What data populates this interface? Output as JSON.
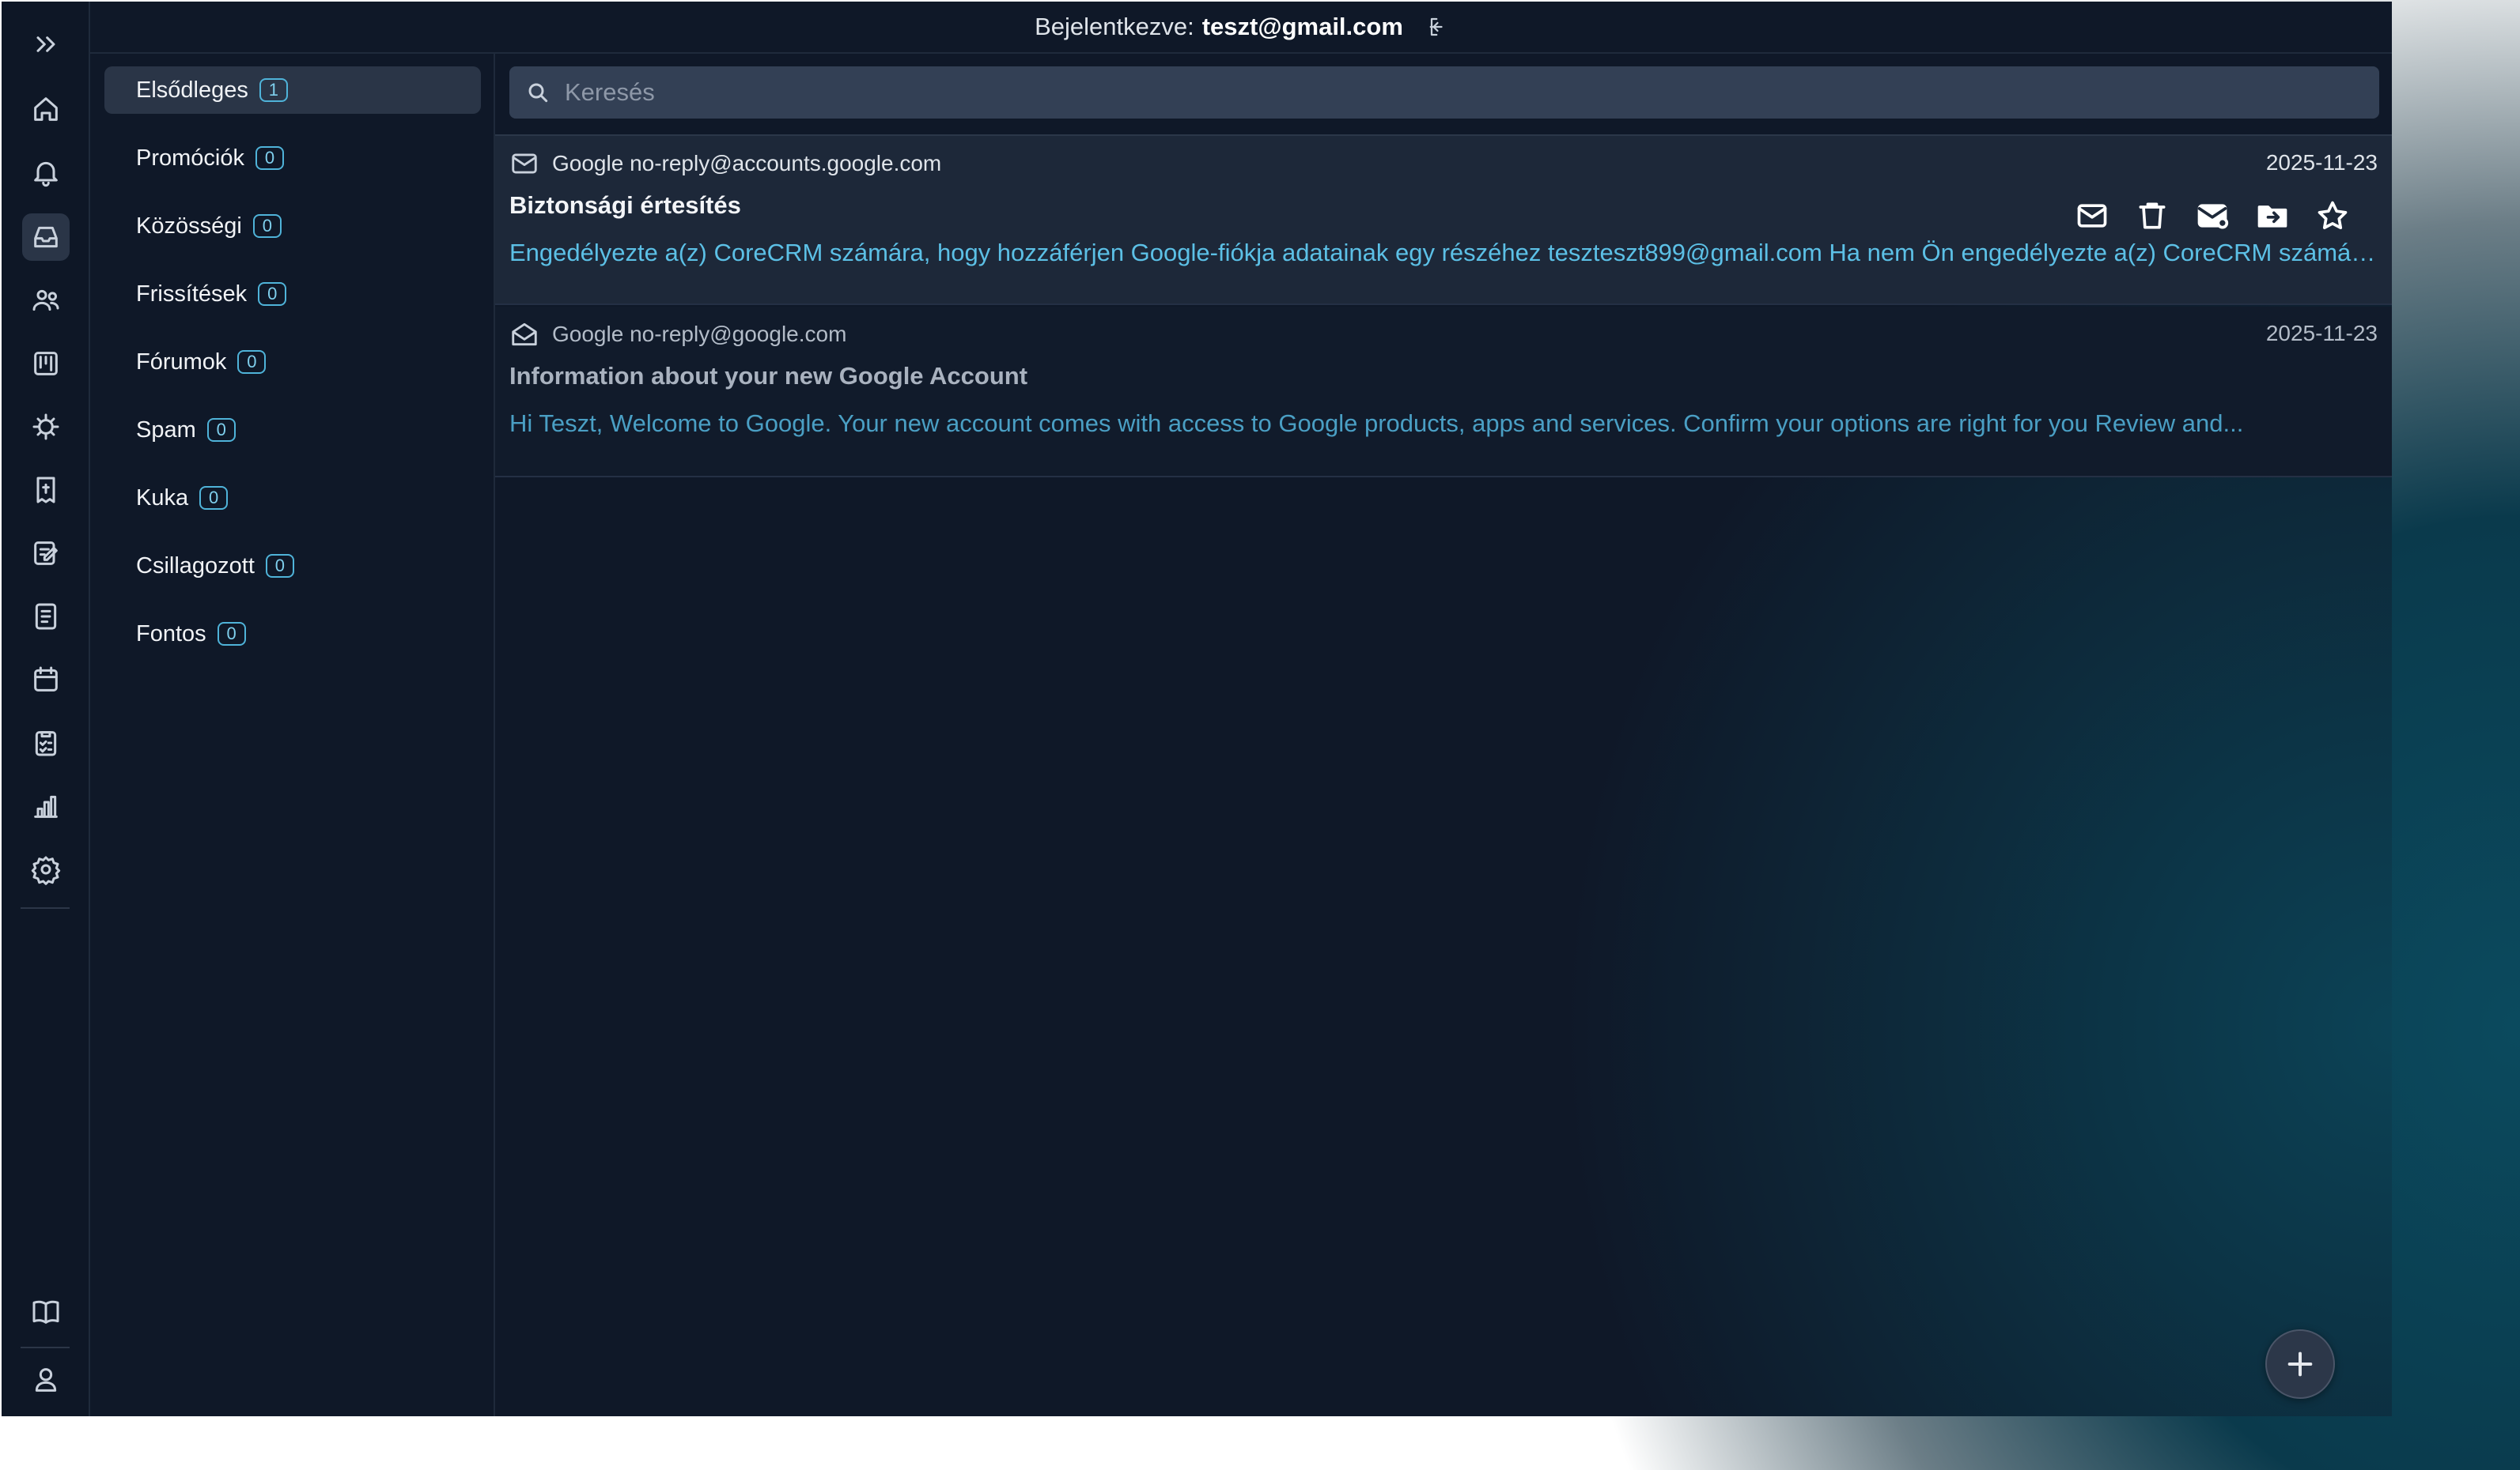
{
  "header": {
    "login_label": "Bejelentkezve:",
    "user_email": "teszt@gmail.com"
  },
  "rail": {
    "items": [
      {
        "icon": "expand-icon"
      },
      {
        "icon": "home-icon"
      },
      {
        "icon": "bell-icon"
      },
      {
        "icon": "inbox-icon",
        "active": true
      },
      {
        "icon": "users-icon"
      },
      {
        "icon": "kanban-icon"
      },
      {
        "icon": "support-icon"
      },
      {
        "icon": "invoice-icon"
      },
      {
        "icon": "edit-icon"
      },
      {
        "icon": "document-icon"
      },
      {
        "icon": "calendar-icon"
      },
      {
        "icon": "checklist-icon"
      },
      {
        "icon": "chart-icon"
      },
      {
        "icon": "gear-icon"
      },
      {
        "icon": "book-icon"
      },
      {
        "icon": "profile-icon"
      }
    ]
  },
  "folders": [
    {
      "label": "Elsődleges",
      "count": "1",
      "active": true
    },
    {
      "label": "Promóciók",
      "count": "0"
    },
    {
      "label": "Közösségi",
      "count": "0"
    },
    {
      "label": "Frissítések",
      "count": "0"
    },
    {
      "label": "Fórumok",
      "count": "0"
    },
    {
      "label": "Spam",
      "count": "0"
    },
    {
      "label": "Kuka",
      "count": "0"
    },
    {
      "label": "Csillagozott",
      "count": "0"
    },
    {
      "label": "Fontos",
      "count": "0"
    }
  ],
  "search": {
    "placeholder": "Keresés",
    "value": ""
  },
  "emails": [
    {
      "from": "Google no-reply@accounts.google.com",
      "date": "2025-11-23",
      "subject": "Biztonsági értesítés",
      "snippet": "Engedélyezte a(z) CoreCRM számára, hogy hozzáférjen Google-fiókja adatainak egy részéhez teszteszt899@gmail.com Ha nem Ön engedélyezte a(z) CoreCRM számára a hozzáférést",
      "unread": true,
      "icons": [
        "mail-closed-icon",
        "trash-icon",
        "mark-unread-icon",
        "move-folder-icon",
        "star-icon"
      ]
    },
    {
      "from": "Google no-reply@google.com",
      "date": "2025-11-23",
      "subject": "Information about your new Google Account",
      "snippet": "Hi Teszt, Welcome to Google. Your new account comes with access to Google products, apps and services. Confirm your options are right for you Review and...",
      "unread": false,
      "icons": [
        "mail-open-icon"
      ]
    }
  ],
  "colors": {
    "background": "#0f1828",
    "accent": "#5cc0e6",
    "badge_border": "#4fb3d9",
    "active_item": "#2a3547"
  }
}
